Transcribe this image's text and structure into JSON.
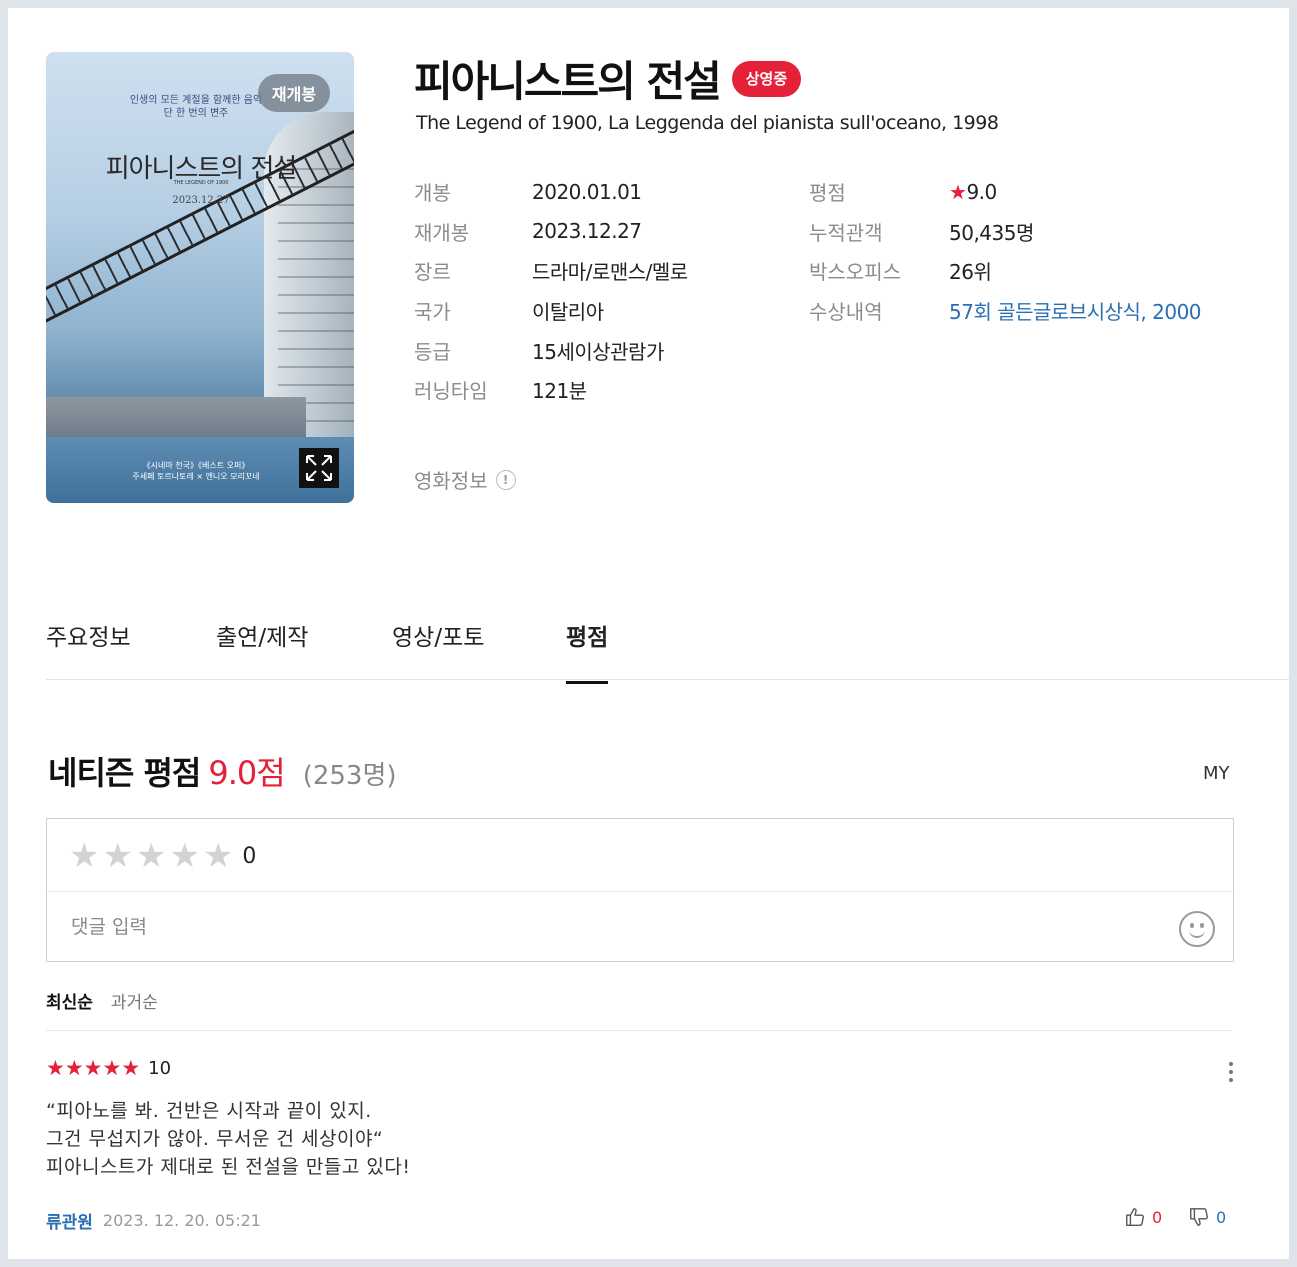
{
  "poster": {
    "reopen_badge": "재개봉",
    "tagline": "인생의 모든 계절을 함께한 음악\n단 한 번의 변주",
    "title": "피아니스트의 전설",
    "subtitle": "THE LEGEND OF 1900",
    "date": "2023.12.27",
    "credits": "《시네마 천국》《베스트 오퍼》\n주세페 토르나토레 × 엔니오 모리꼬네"
  },
  "movie": {
    "title": "피아니스트의 전설",
    "status_badge": "상영중",
    "subtitle": "The Legend of 1900, La Leggenda del pianista sull'oceano, 1998"
  },
  "info_left": [
    {
      "label": "개봉",
      "value": "2020.01.01"
    },
    {
      "label": "재개봉",
      "value": "2023.12.27"
    },
    {
      "label": "장르",
      "value": "드라마/로맨스/멜로"
    },
    {
      "label": "국가",
      "value": "이탈리아"
    },
    {
      "label": "등급",
      "value": "15세이상관람가"
    },
    {
      "label": "러닝타임",
      "value": "121분"
    }
  ],
  "info_right": [
    {
      "label": "평점",
      "star": "★",
      "value": "9.0"
    },
    {
      "label": "누적관객",
      "value": "50,435명"
    },
    {
      "label": "박스오피스",
      "value": "26위"
    },
    {
      "label": "수상내역",
      "value": "57회 골든글로브시상식, 2000"
    }
  ],
  "movie_info_link": "영화정보",
  "tabs": [
    "주요정보",
    "출연/제작",
    "영상/포토",
    "평점"
  ],
  "active_tab": "평점",
  "rating": {
    "label": "네티즌 평점",
    "score": "9.0점",
    "count": "(253명)",
    "my_link": "MY"
  },
  "input": {
    "star_value": "0",
    "placeholder": "댓글 입력"
  },
  "sort": [
    "최신순",
    "과거순"
  ],
  "review": {
    "stars": 5,
    "score": "10",
    "text": "“피아노를 봐. 건반은 시작과 끝이 있지.\n그건 무섭지가 않아. 무서운 건 세상이야“\n피아니스트가 제대로 된 전설을 만들고 있다!",
    "author": "류관원",
    "date": "2023. 12. 20. 05:21",
    "likes": "0",
    "dislikes": "0"
  },
  "colors": {
    "accent_red": "#e5213a",
    "link_blue": "#2a6fb5"
  }
}
